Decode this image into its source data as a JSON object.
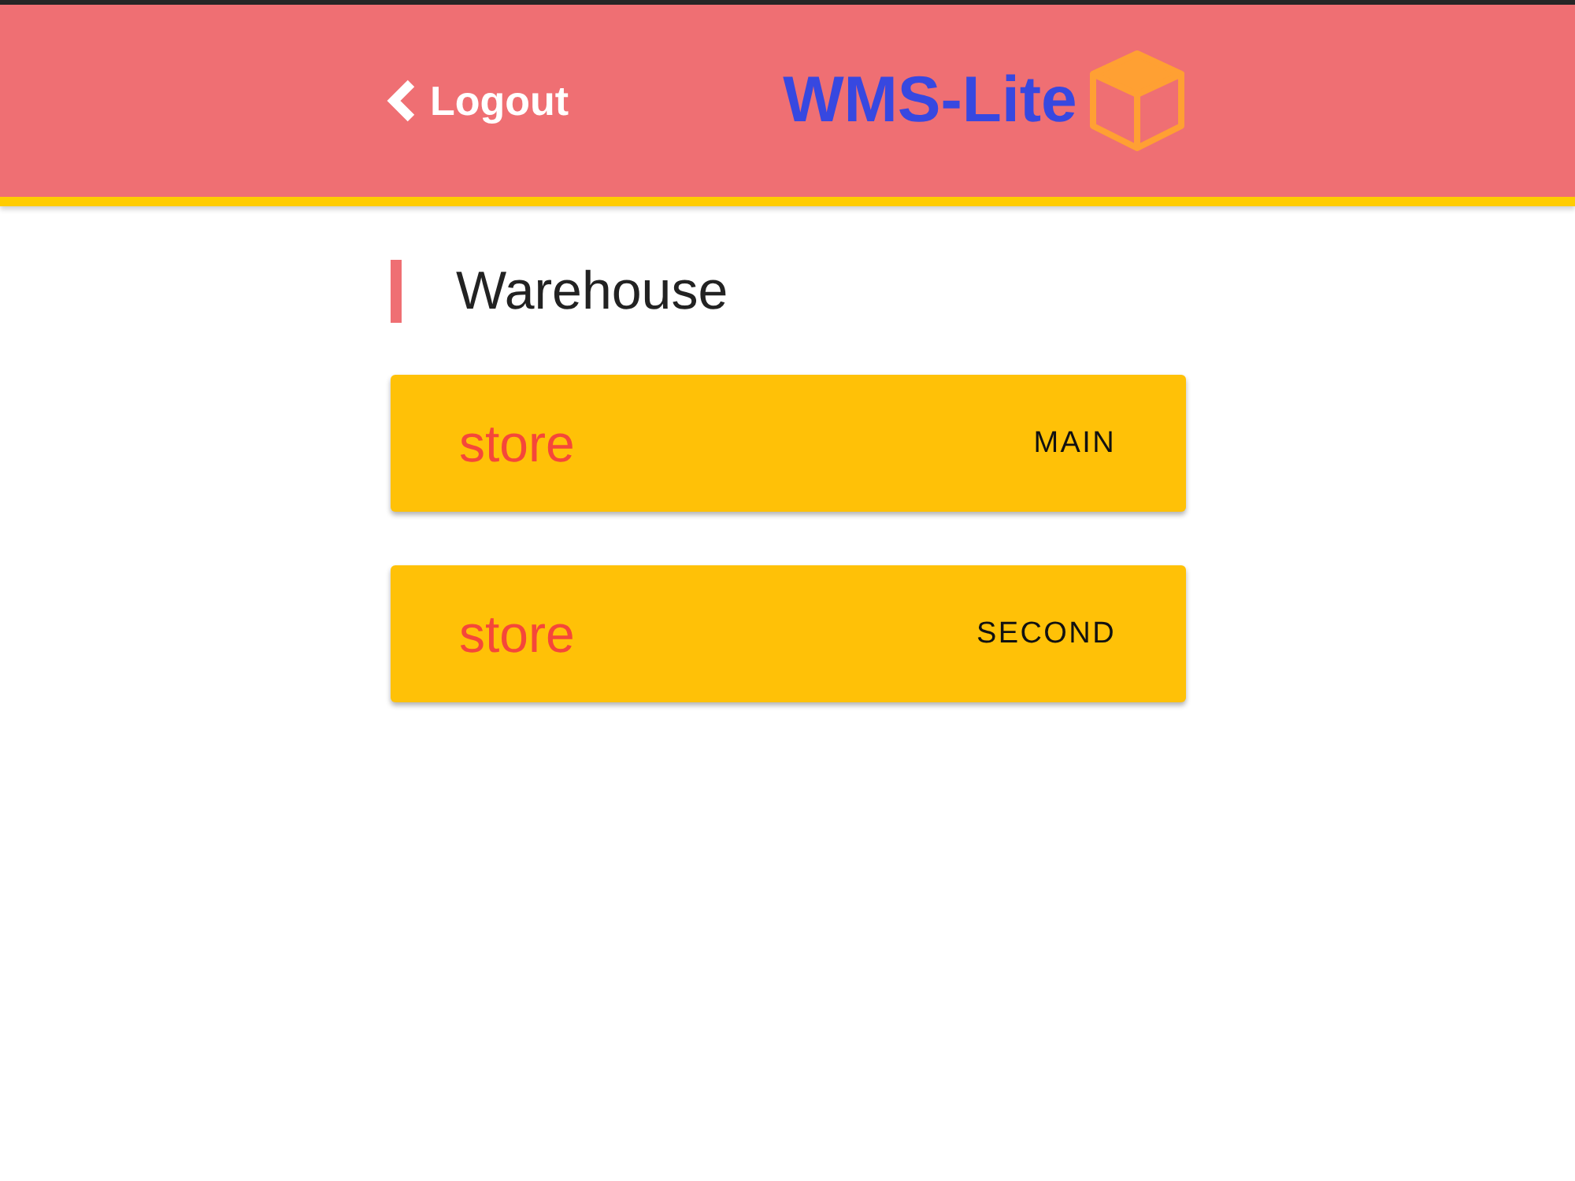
{
  "header": {
    "back_button": {
      "label": "Logout"
    },
    "logo": {
      "text": "WMS-Lite"
    }
  },
  "section": {
    "title": "Warehouse"
  },
  "stores": [
    {
      "label": "store",
      "name": "MAIN"
    },
    {
      "label": "store",
      "name": "SECOND"
    }
  ]
}
